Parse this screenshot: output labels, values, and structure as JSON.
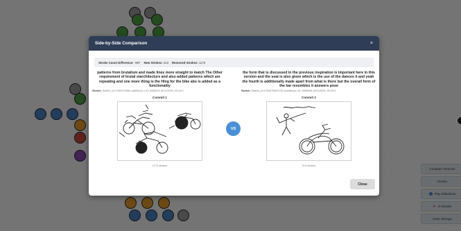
{
  "modal": {
    "title": "Side-by-Side Comparison",
    "close_icon": "×",
    "close_button": "Close"
  },
  "stats": {
    "stroke_diff_label": "Stroke Count Difference:",
    "stroke_diff_value": "-957",
    "new_label": "New Strokes:",
    "new_value": "213",
    "removed_label": "Removed Strokes:",
    "removed_value": "1170"
  },
  "vs_label": "VS",
  "commits": [
    {
      "prompt": "patterns from brutalism and made lines more straight to match The Other requirement of brutal starchitecture and also added patterns which are repeating and one more thing is the Hing for the bike abo is added as a functionality",
      "meta_label": "Sketch:",
      "meta_value": "Sketch_id:1760072286L addition1c | ID: 8408210 (9/11/2025, 23:14:0",
      "commit_label": "Commit 1",
      "strokes": "1170 strokes"
    },
    {
      "prompt": "the form that is discussed in the previous inspiration is important here in this version and the seat is also given which is the use of the dances it and yeah the fourth is additionally made apart from what is there but the overall form of the bar resembles it answers pose",
      "meta_label": "Sketch:",
      "meta_value": "Sketch_id:1760079487128 onedistrop | ID: 8985e68 (9/11/2025, 00:43:3",
      "commit_label": "Commit 2",
      "strokes": "213 strokes"
    }
  ],
  "side_panel": {
    "compare_versions": "Compare Versions",
    "history": "History",
    "play_slideshow": "Play Slideshow",
    "ai_render": "AI Render",
    "clear_storage": "Clear Storage"
  },
  "colors": {
    "header": "#2f3e56",
    "vs_badge": "#4a8fd6",
    "node_green": "#4f9f43",
    "node_blue": "#4a7fc2",
    "node_orange": "#e39c2c",
    "node_red": "#c84a3a",
    "node_purple": "#8a4bb0"
  }
}
